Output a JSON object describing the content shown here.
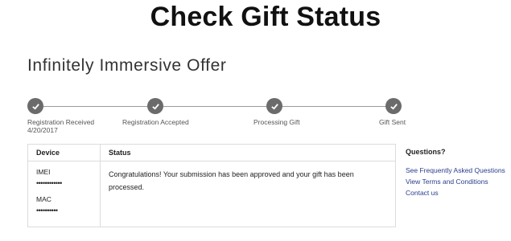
{
  "page": {
    "title": "Check Gift Status"
  },
  "offer": {
    "title": "Infinitely Immersive Offer"
  },
  "tracker": {
    "steps": [
      {
        "label": "Registration Received",
        "date": "4/20/2017",
        "icon": "check-icon"
      },
      {
        "label": "Registration Accepted",
        "icon": "check-icon"
      },
      {
        "label": "Processing Gift",
        "icon": "check-icon"
      },
      {
        "label": "Gift Sent",
        "icon": "check-icon"
      }
    ]
  },
  "table": {
    "headers": {
      "device": "Device",
      "status": "Status"
    },
    "device": {
      "imei_label": "IMEI",
      "imei_value": "••••••••••••",
      "mac_label": "MAC",
      "mac_value": "••••••••••"
    },
    "status_text": "Congratulations! Your submission has been approved and your gift has been processed."
  },
  "questions": {
    "title": "Questions?",
    "links": [
      "See Frequently Asked Questions",
      "View Terms and Conditions",
      "Contact us"
    ]
  },
  "colors": {
    "step_circle": "#6b6b6b",
    "link": "#2a3d8f",
    "border": "#dcdcdc"
  }
}
